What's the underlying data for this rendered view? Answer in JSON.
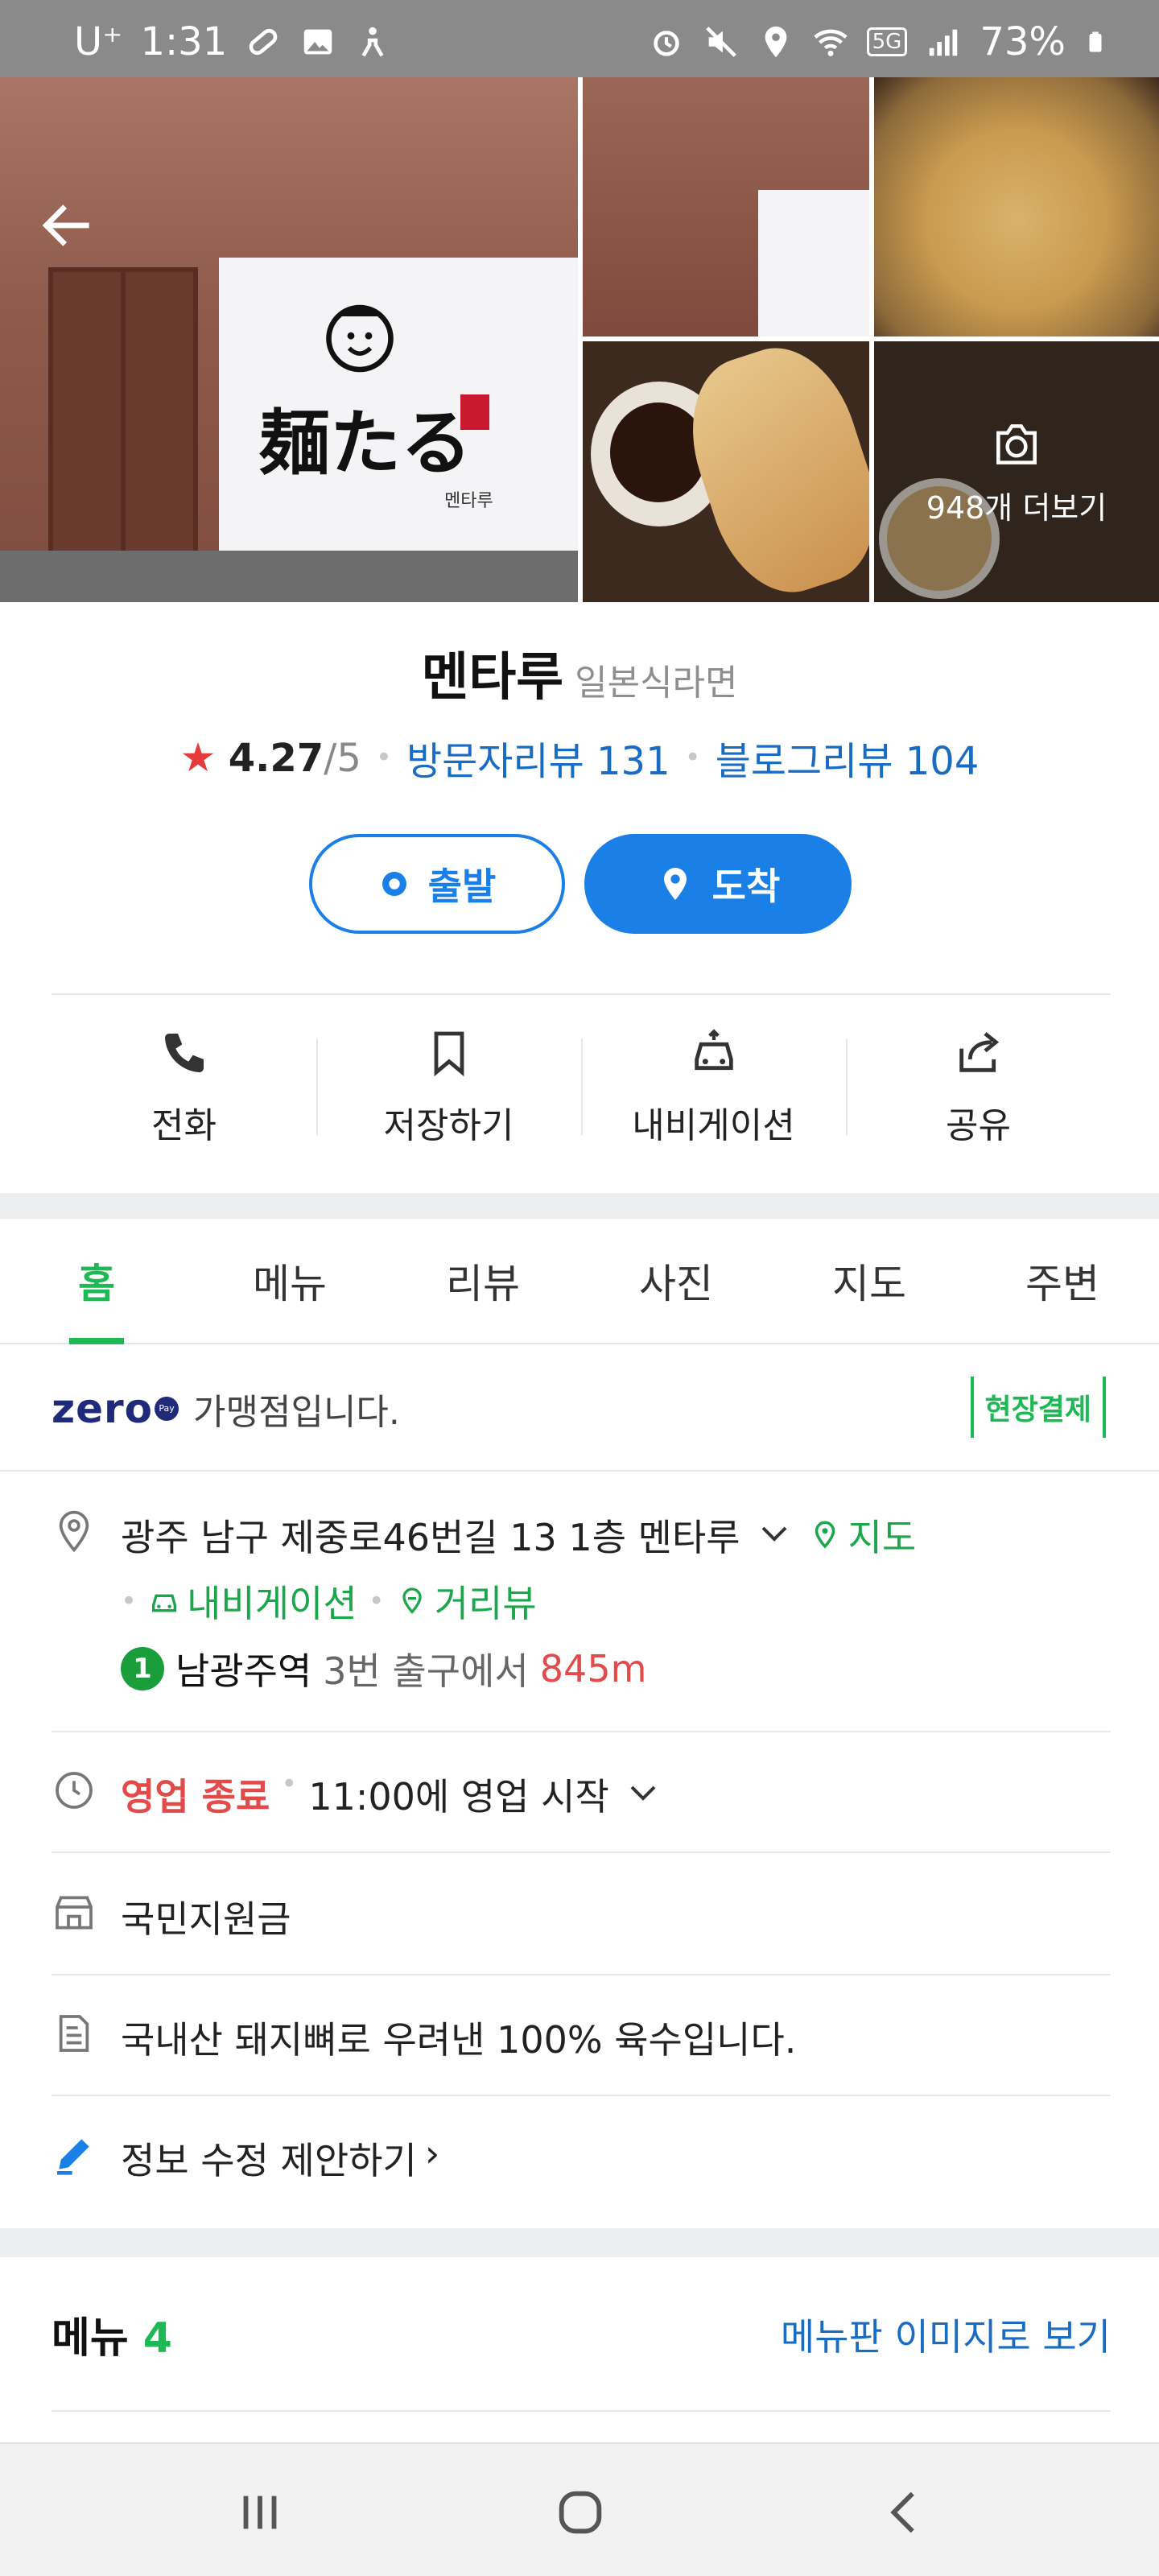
{
  "status_bar": {
    "carrier": "U⁺",
    "time": "1:31",
    "network": "5G",
    "battery": "73%",
    "background": "#8a8a8a"
  },
  "photos": {
    "more_count_label": "948개 더보기",
    "sign_text": "麺たる",
    "sign_sub": "멘타루"
  },
  "place": {
    "name": "멘타루",
    "category": "일본식라면",
    "rating_star": "★",
    "rating": "4.27",
    "rating_max": "/5",
    "visitor_reviews": "방문자리뷰 131",
    "blog_reviews": "블로그리뷰 104"
  },
  "route_buttons": {
    "start": "출발",
    "arrive": "도착",
    "accent": "#1a7fe6"
  },
  "actions": [
    {
      "label": "전화",
      "icon": "phone-icon"
    },
    {
      "label": "저장하기",
      "icon": "bookmark-icon"
    },
    {
      "label": "내비게이션",
      "icon": "car-icon"
    },
    {
      "label": "공유",
      "icon": "share-icon"
    }
  ],
  "tabs": [
    {
      "label": "홈",
      "active": true
    },
    {
      "label": "메뉴"
    },
    {
      "label": "리뷰"
    },
    {
      "label": "사진"
    },
    {
      "label": "지도"
    },
    {
      "label": "주변"
    }
  ],
  "zeropay": {
    "logo": "zero",
    "logo_badge": "Pay",
    "text": "가맹점입니다.",
    "onsite_payment": "현장결제"
  },
  "address": {
    "text": "광주 남구 제중로46번길 13 1층 멘타루",
    "map_link": "지도",
    "navigation_link": "내비게이션",
    "street_view_link": "거리뷰",
    "subway_line": "1",
    "station": "남광주역",
    "exit_text": "3번 출구에서",
    "distance": "845m"
  },
  "hours": {
    "status": "영업 종료",
    "next": "11:00에 영업 시작"
  },
  "support": {
    "text": "국민지원금"
  },
  "description": {
    "text": "국내산 돼지뼈로 우려낸 100% 육수입니다."
  },
  "edit": {
    "text": "정보 수정 제안하기",
    "chevron": "›"
  },
  "menu_section": {
    "title": "메뉴",
    "count": "4",
    "image_link": "메뉴판 이미지로 보기"
  },
  "colors": {
    "green": "#1db954",
    "blue_link": "#1a6cc2",
    "red": "#e34a4a"
  }
}
